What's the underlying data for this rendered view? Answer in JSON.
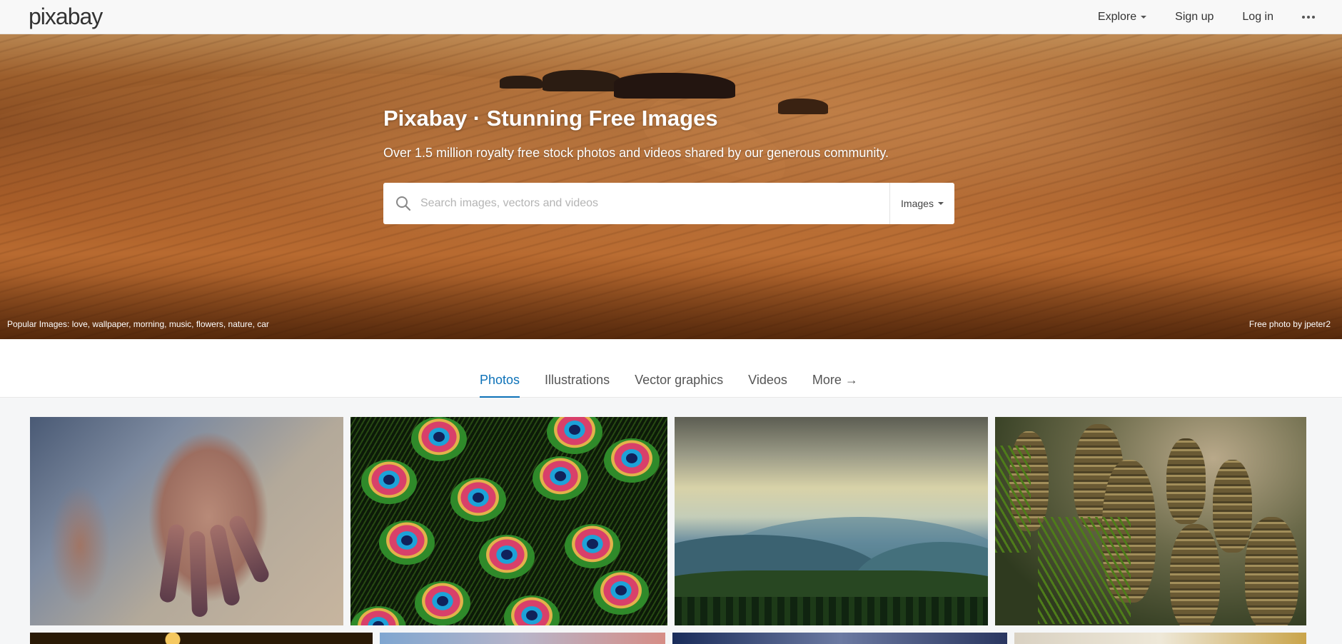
{
  "header": {
    "logo": "pixabay",
    "nav": {
      "explore": "Explore",
      "signup": "Sign up",
      "login": "Log in"
    }
  },
  "hero": {
    "title": "Pixabay · Stunning Free Images",
    "subtitle": "Over 1.5 million royalty free stock photos and videos shared by our generous community.",
    "search": {
      "placeholder": "Search images, vectors and videos",
      "type": "Images"
    },
    "popular_label": "Popular Images:",
    "popular_tags": [
      "love",
      "wallpaper",
      "morning",
      "music",
      "flowers",
      "nature",
      "car"
    ],
    "credit": "Free photo by jpeter2"
  },
  "tabs": [
    "Photos",
    "Illustrations",
    "Vector graphics",
    "Videos",
    "More →"
  ],
  "active_tab": "Photos",
  "colors": {
    "accent": "#0d72b8",
    "topbar_bg": "#f8f8f8"
  },
  "icons": [
    "search-icon",
    "caret-down-icon",
    "more-dots-icon"
  ]
}
